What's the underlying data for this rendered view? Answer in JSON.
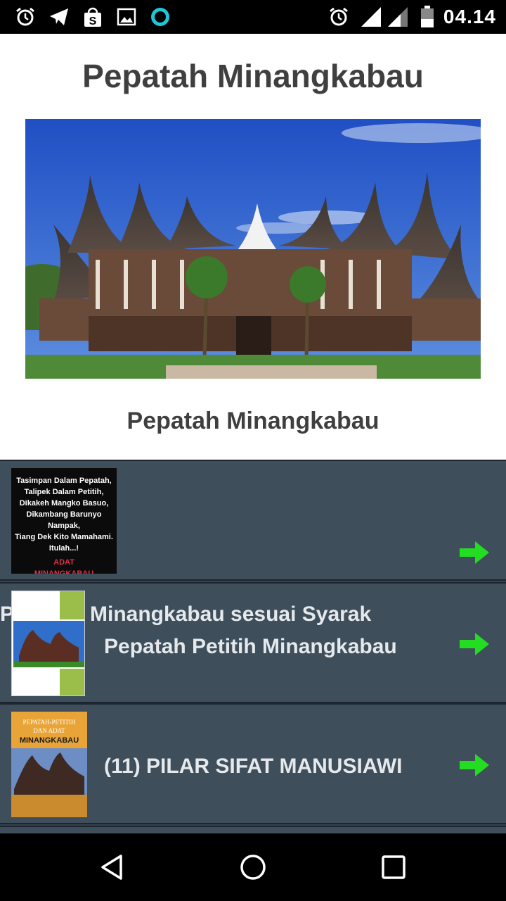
{
  "status_bar": {
    "time": "04.14",
    "left_icons": [
      "alarm-icon",
      "telegram-icon",
      "shop-bag-icon",
      "image-icon",
      "circle-app-icon"
    ],
    "right_icons": [
      "alarm-icon",
      "signal-icon",
      "signal-icon",
      "battery-icon"
    ]
  },
  "page": {
    "title": "Pepatah Minangkabau",
    "hero_caption": "Pepatah Minangkabau"
  },
  "hero_poster": {
    "lines": [
      "Tasimpan Dalam Pepatah,",
      "Talipek Dalam Petitih,",
      "Dikakeh Mangko Basuo,",
      "Dikambang Barunyo Nampak,",
      "Tiang Dek Kito Mamahami.",
      "Itulah...!"
    ],
    "accent": [
      "ADAT",
      "MINANGKABAU"
    ]
  },
  "list": {
    "items": [
      {
        "title": "",
        "thumb_lines": [
          "Tasimpan Dalam Pepatah,",
          "Talipek Dalam Petitih,",
          "Dikakeh Mangko Basuo,",
          "Dikambang Barunyo Nampak,",
          "Tiang Dek Kito Mamahami.",
          "Itulah...!"
        ],
        "thumb_accent_1": "ADAT",
        "thumb_accent_2": "MINANGKABAU"
      },
      {
        "title_line_1": "P",
        "title_line_1b": "Minangkabau sesuai Syarak",
        "title_line_2": "Pepatah Petitih Minangkabau"
      },
      {
        "title": "(11) PILAR SIFAT MANUSIAWI",
        "thumb_title_1": "PEPATAH-PETITIH",
        "thumb_title_2": "DAN ADAT",
        "thumb_title_3": "MINANGKABAU"
      }
    ]
  },
  "colors": {
    "list_bg": "#3e4e5b",
    "arrow": "#22dd22",
    "title_text": "#3f3f3f"
  }
}
